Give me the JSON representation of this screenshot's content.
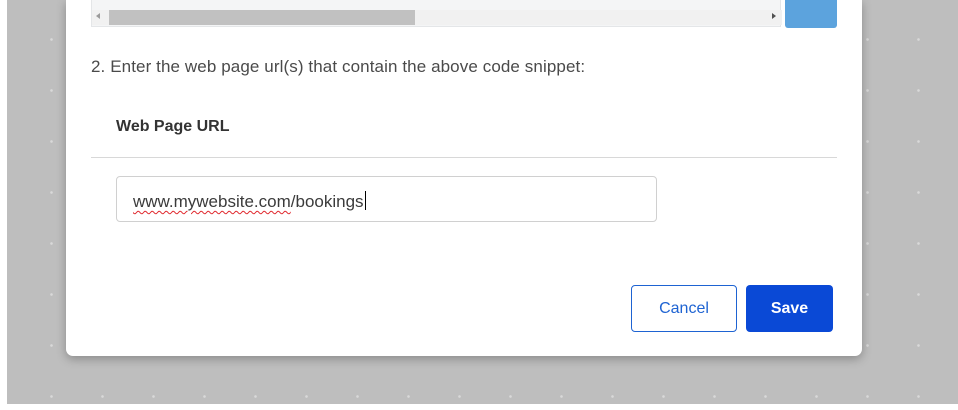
{
  "dialog": {
    "step_label": "2. Enter the web page url(s) that contain the above code snippet:",
    "column_header": "Web Page URL",
    "url_input": {
      "value_part1": "www.mywebsite.com",
      "value_part2": "/bookings"
    },
    "buttons": {
      "cancel_label": "Cancel",
      "save_label": "Save"
    }
  },
  "colors": {
    "primary": "#0a49d6",
    "outline_button": "#1e63d2",
    "copy_button": "#5ca3dd",
    "backdrop": "#bebebe",
    "spellcheck_underline": "#e0262c"
  },
  "icons": {
    "scroll_left": "scroll-left-arrow-icon",
    "scroll_right": "scroll-right-arrow-icon"
  }
}
